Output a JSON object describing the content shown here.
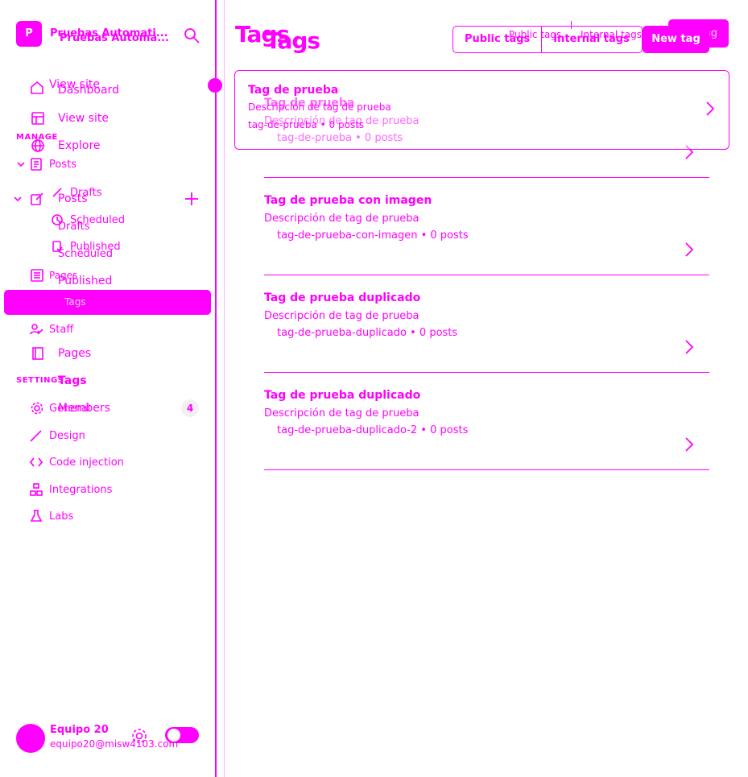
{
  "brand": {
    "name": "Pruebas Automati...",
    "name_ghost": "Pruebas Automa..."
  },
  "nav": {
    "view_site_top": "View site",
    "dashboard": "Dashboard",
    "view_site": "View site",
    "manage": "MANAGE",
    "explore": "Explore",
    "posts": "Posts",
    "drafts_top": "Drafts",
    "posts_2": "Posts",
    "scheduled_top": "Scheduled",
    "drafts": "Drafts",
    "published_top": "Published",
    "scheduled": "Scheduled",
    "pages_top": "Pages",
    "published": "Published",
    "tags_active": "Tags",
    "staff": "Staff",
    "pages": "Pages",
    "settings": "SETTINGS",
    "tags": "Tags",
    "general": "General",
    "members": "Members",
    "members_count": "4",
    "design": "Design",
    "code_injection": "Code injection",
    "integrations": "Integrations",
    "labs": "Labs"
  },
  "footer": {
    "name": "Equipo 20",
    "email": "equipo20@misw4103.com"
  },
  "main": {
    "title": "Tags",
    "title_ghost": "Tags",
    "filters": {
      "public": "Public tags",
      "internal": "Internal tags"
    },
    "new_tag": "New tag",
    "new_tag_ghost": "New tag"
  },
  "hover_card": {
    "name": "Tag de prueba",
    "desc": "Descripción de tag de prueba",
    "meta": "tag-de-prueba • 0 posts"
  },
  "tags": [
    {
      "name": "Tag de prueba",
      "desc": "Descripción de tag de prueba",
      "meta": "tag-de-prueba • 0 posts"
    },
    {
      "name": "Tag de prueba con imagen",
      "desc": "Descripción de tag de prueba",
      "meta": "tag-de-prueba-con-imagen • 0 posts"
    },
    {
      "name": "Tag de prueba duplicado",
      "desc": "Descripción de tag de prueba",
      "meta": "tag-de-prueba-duplicado • 0 posts"
    },
    {
      "name": "Tag de prueba duplicado",
      "desc": "Descripción de tag de prueba",
      "meta": "tag-de-prueba-duplicado-2 • 0 posts"
    }
  ],
  "colors": {
    "accent": "#ff00ff",
    "background": "#ffffff"
  }
}
